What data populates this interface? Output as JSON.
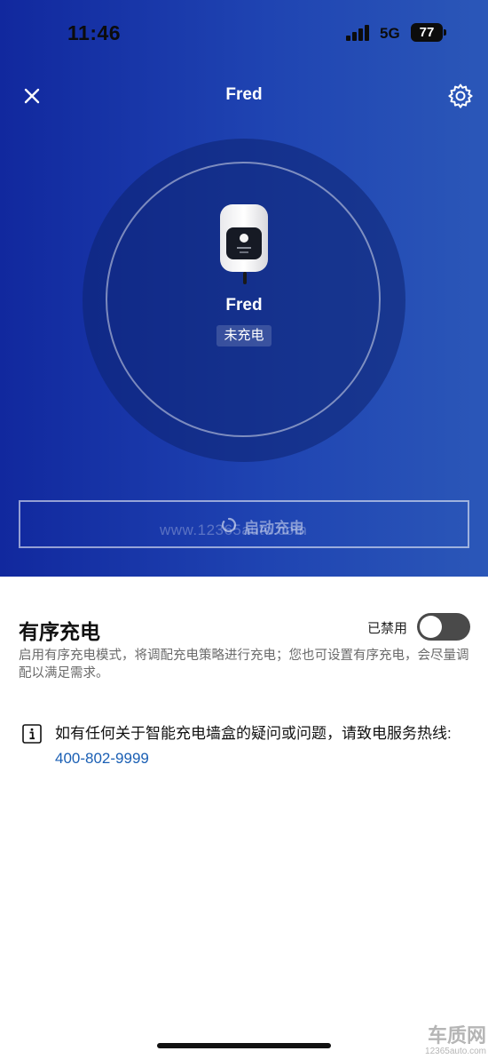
{
  "status_bar": {
    "time": "11:46",
    "network": "5G",
    "battery": "77"
  },
  "header": {
    "title": "Fred",
    "close_icon": "close-icon",
    "settings_icon": "gear-icon"
  },
  "device": {
    "name": "Fred",
    "status": "未充电",
    "image_icon": "wall-charger-icon"
  },
  "actions": {
    "start_charge_label": "启动充电",
    "loading_icon": "spinner-icon"
  },
  "watermark": {
    "center_text": "www.12365auto.com",
    "brand_big": "车质网",
    "brand_small": "12365auto.com"
  },
  "ordered_charging": {
    "title": "有序充电",
    "toggle_label": "已禁用",
    "enabled": false,
    "description": "启用有序充电模式，将调配充电策略进行充电；您也可设置有序充电，会尽量调配以满足需求。"
  },
  "info": {
    "icon": "info-icon",
    "text": "如有任何关于智能充电墙盒的疑问或问题，请致电服务热线: ",
    "hotline": "400-802-9999"
  },
  "colors": {
    "hero_start": "#11289e",
    "hero_end": "#2b57b8",
    "toggle_off": "#4a4a4a",
    "link": "#1a5fb4"
  }
}
